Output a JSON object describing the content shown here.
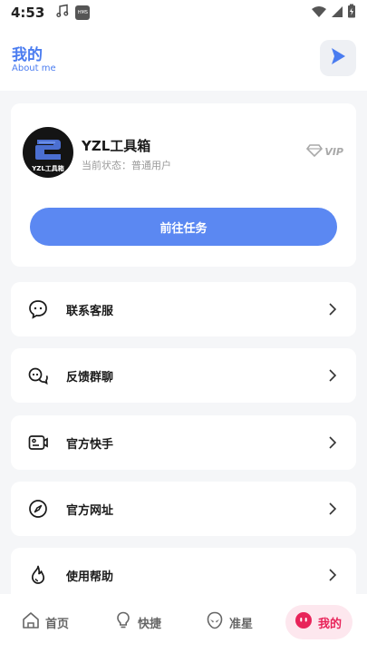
{
  "status_bar": {
    "time": "4:53",
    "hms_label": "HMS"
  },
  "header": {
    "title": "我的",
    "subtitle": "About me"
  },
  "profile": {
    "avatar_text": "YZL工具箱",
    "name": "YZL工具箱",
    "status": "当前状态：普通用户",
    "vip_label": "VIP",
    "task_button": "前往任务"
  },
  "menu": {
    "items": [
      {
        "label": "联系客服",
        "icon": "chat-bubble-icon"
      },
      {
        "label": "反馈群聊",
        "icon": "group-chat-icon"
      },
      {
        "label": "官方快手",
        "icon": "kuaishou-icon"
      },
      {
        "label": "官方网址",
        "icon": "compass-icon"
      },
      {
        "label": "使用帮助",
        "icon": "flame-icon"
      }
    ]
  },
  "nav": {
    "items": [
      {
        "label": "首页",
        "icon": "home-icon"
      },
      {
        "label": "快捷",
        "icon": "bulb-icon"
      },
      {
        "label": "准星",
        "icon": "alien-icon"
      },
      {
        "label": "我的",
        "icon": "face-icon"
      }
    ],
    "active_index": 3
  },
  "colors": {
    "accent": "#4a7cf0",
    "button": "#5b88f2",
    "nav_active": "#e8245a",
    "nav_active_bg": "#fde7ee"
  }
}
